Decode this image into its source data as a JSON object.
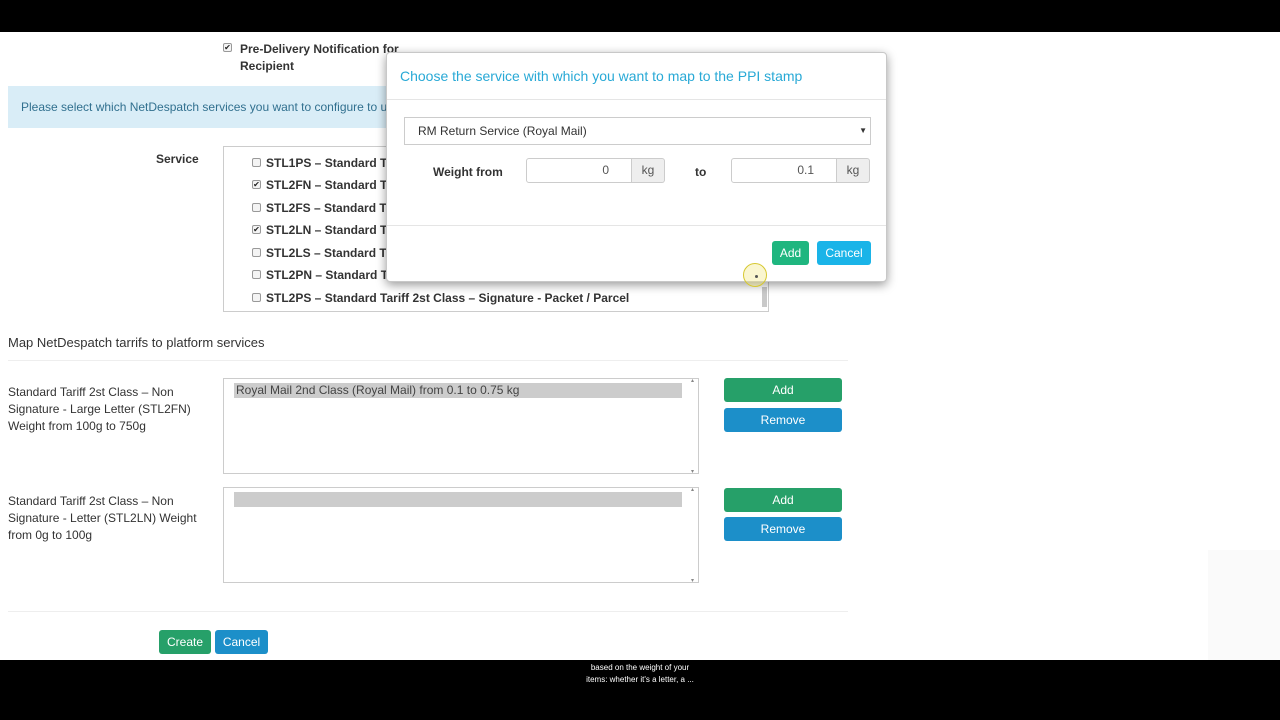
{
  "page": {
    "pre_delivery_label": "Pre-Delivery Notification for Recipient",
    "info_text": "Please select which NetDespatch services you want to configure to use",
    "service_label": "Service",
    "services": [
      {
        "label": "STL1PS – Standard Ta",
        "checked": false
      },
      {
        "label": "STL2FN – Standard Ta",
        "checked": true
      },
      {
        "label": "STL2FS – Standard Ta",
        "checked": false
      },
      {
        "label": "STL2LN – Standard Ta",
        "checked": true
      },
      {
        "label": "STL2LS – Standard Ta",
        "checked": false
      },
      {
        "label": "STL2PN – Standard Ta",
        "checked": false
      },
      {
        "label": "STL2PS – Standard Tariff 2st Class – Signature - Packet / Parcel",
        "checked": false
      }
    ],
    "map_title": "Map NetDespatch tarrifs to platform services",
    "mappings": [
      {
        "description": "Standard Tariff 2st Class – Non Signature - Large Letter (STL2FN) Weight from 100g to 750g",
        "selected_option": "Royal Mail 2nd Class (Royal Mail) from 0.1 to 0.75 kg",
        "add_label": "Add",
        "remove_label": "Remove"
      },
      {
        "description": "Standard Tariff 2st Class – Non Signature - Letter (STL2LN) Weight from 0g to 100g",
        "selected_option": "",
        "add_label": "Add",
        "remove_label": "Remove"
      }
    ],
    "create_label": "Create",
    "cancel_label": "Cancel"
  },
  "modal": {
    "title": "Choose the service with which you want to map to the PPI stamp",
    "service_select_value": "RM Return Service (Royal Mail)",
    "weight_from_label": "Weight from",
    "weight_from_value": "0",
    "weight_unit": "kg",
    "to_label": "to",
    "weight_to_value": "0.1",
    "add_label": "Add",
    "cancel_label": "Cancel"
  },
  "caption": {
    "line1": "based on the weight of your",
    "line2": "items: whether it's a letter, a ..."
  },
  "colors": {
    "modal_title": "#28a9d6",
    "info_bg": "#d9edf7",
    "add_green": "#26a069",
    "remove_blue": "#1c8fc9"
  }
}
